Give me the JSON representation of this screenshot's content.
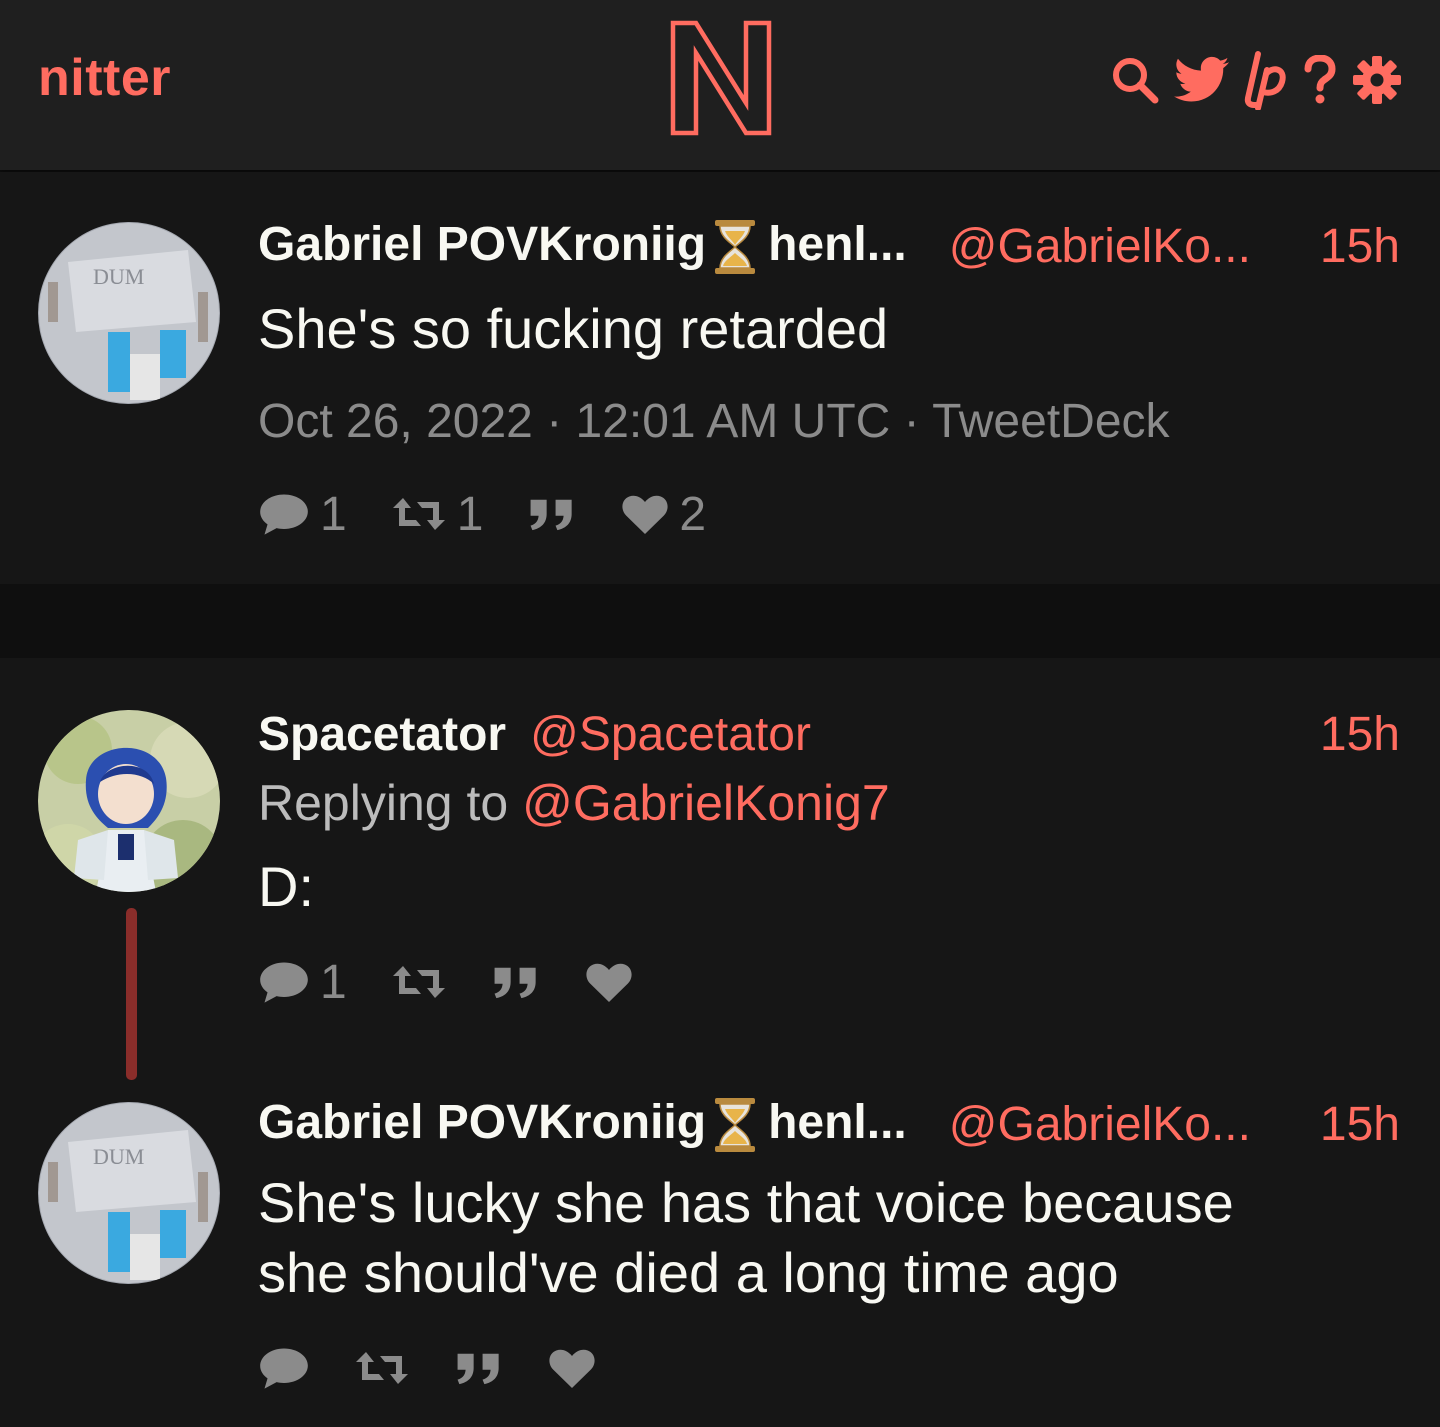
{
  "nav": {
    "brand": "nitter",
    "logo_letter": "N",
    "icons": [
      "search-icon",
      "twitter-bird-icon",
      "liberapay-icon",
      "help-icon",
      "gear-icon"
    ],
    "help_label": "?"
  },
  "colors": {
    "accent": "#ff6c60",
    "background": "#0f0f0f",
    "card": "#161616",
    "navbar": "#1f1f1f",
    "muted": "#8b8b8b",
    "thread_line": "#8a2d2a"
  },
  "main_tweet": {
    "fullname_prefix": "Gabriel POVKroniig",
    "fullname_suffix": "henl...",
    "emoji": "hourglass",
    "username": "@GabrielKo...",
    "timestamp": "15h",
    "text": "She's so fucking retarded",
    "published": "Oct 26, 2022 · 12:01 AM UTC · TweetDeck",
    "stats": {
      "replies": "1",
      "retweets": "1",
      "quotes": "",
      "likes": "2"
    }
  },
  "reply_1": {
    "fullname": "Spacetator",
    "username": "@Spacetator",
    "timestamp": "15h",
    "replying_label": "Replying to",
    "replying_handle": "@GabrielKonig7",
    "text": "D:",
    "stats": {
      "replies": "1",
      "retweets": "",
      "quotes": "",
      "likes": ""
    }
  },
  "reply_2": {
    "fullname_prefix": "Gabriel POVKroniig",
    "fullname_suffix": "henl...",
    "emoji": "hourglass",
    "username": "@GabrielKo...",
    "timestamp": "15h",
    "text": "She's lucky she has that voice because she should've died a long time ago",
    "stats": {
      "replies": "",
      "retweets": "",
      "quotes": "",
      "likes": ""
    }
  }
}
